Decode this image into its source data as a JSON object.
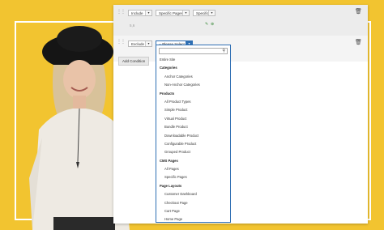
{
  "conditions": [
    {
      "action": "Include",
      "page_type": "Specific Pages",
      "selector": "Specific",
      "value": "5,6"
    },
    {
      "action": "Exclude",
      "page_type": "-- Please Select --"
    }
  ],
  "add_condition_label": "Add Condition",
  "dropdown": {
    "search_placeholder": "",
    "items": [
      {
        "text": "Entire Site",
        "kind": "top"
      },
      {
        "text": "Categories",
        "kind": "group"
      },
      {
        "text": "Anchor Categories",
        "kind": "opt"
      },
      {
        "text": "Non-Anchor Categories",
        "kind": "opt"
      },
      {
        "text": "Products",
        "kind": "group"
      },
      {
        "text": "All Product Types",
        "kind": "opt"
      },
      {
        "text": "Simple Product",
        "kind": "opt"
      },
      {
        "text": "Virtual Product",
        "kind": "opt"
      },
      {
        "text": "Bundle Product",
        "kind": "opt"
      },
      {
        "text": "Downloadable Product",
        "kind": "opt"
      },
      {
        "text": "Configurable Product",
        "kind": "opt"
      },
      {
        "text": "Grouped Product",
        "kind": "opt"
      },
      {
        "text": "CMS Pages",
        "kind": "group"
      },
      {
        "text": "All Pages",
        "kind": "opt"
      },
      {
        "text": "Specific Pages",
        "kind": "opt"
      },
      {
        "text": "Page Layouts",
        "kind": "group"
      },
      {
        "text": "Customer Dashboard",
        "kind": "opt"
      },
      {
        "text": "Checkout Page",
        "kind": "opt"
      },
      {
        "text": "Cart Page",
        "kind": "opt"
      },
      {
        "text": "Home Page",
        "kind": "opt"
      }
    ]
  },
  "colors": {
    "backdrop": "#f2c430",
    "accent": "#2f6fb3"
  }
}
